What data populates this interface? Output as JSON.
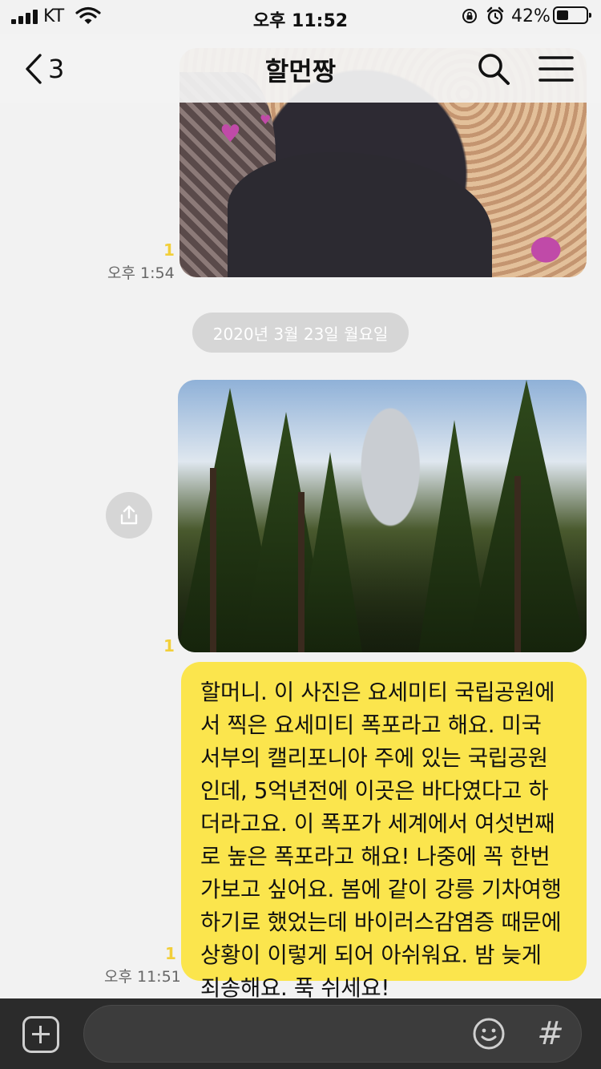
{
  "status_bar": {
    "carrier": "KT",
    "time": "오후 11:52",
    "battery_percent": "42%",
    "battery_level": 0.42
  },
  "header": {
    "back_count": "3",
    "title": "할먼짱"
  },
  "chat": {
    "photo1": {
      "read_count": "1",
      "time": "오후 1:54"
    },
    "date_divider": "2020년 3월 23일 월요일",
    "photo2": {
      "read_count": "1"
    },
    "message": {
      "lines": [
        "할머니. 이 사진은 요세미티 국립공원에",
        "서 찍은 요세미티 폭포라고 해요. 미국",
        "서부의 캘리포니아 주에 있는 국립공원",
        "인데, 5억년전에 이곳은 바다였다고 하",
        "더라고요. 이 폭포가 세계에서 여섯번째",
        "로 높은 폭포라고 해요! 나중에 꼭 한번",
        "가보고 싶어요. 봄에 같이 강릉 기차여행",
        "하기로 했었는데 바이러스감염증 때문에",
        "상황이 이렇게 되어 아쉬워요. 밤 늦게",
        "죄송해요. 푹 쉬세요!"
      ],
      "read_count": "1",
      "time": "오후 11:51"
    }
  },
  "input_bar": {
    "value": "",
    "hash_label": "#"
  },
  "colors": {
    "my_bubble": "#fbe54d",
    "read_count": "#f2cf3a",
    "background": "#f2f2f2",
    "input_bar": "#2b2b2b"
  },
  "icons": [
    "back-chevron-icon",
    "search-icon",
    "menu-icon",
    "share-icon",
    "plus-icon",
    "emoji-icon",
    "hash-icon"
  ]
}
